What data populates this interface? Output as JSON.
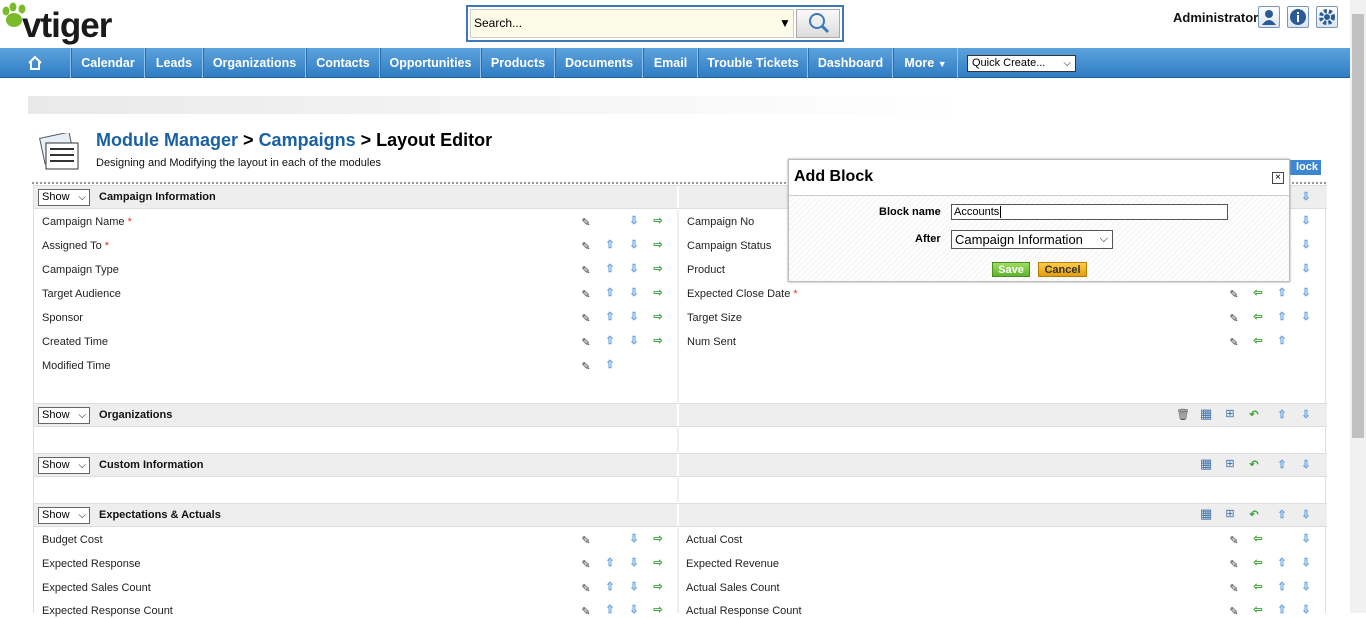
{
  "app": {
    "brand": "vtiger"
  },
  "search": {
    "placeholder": "Search..."
  },
  "user": {
    "name": "Administrator"
  },
  "nav": {
    "items": [
      "Calendar",
      "Leads",
      "Organizations",
      "Contacts",
      "Opportunities",
      "Products",
      "Documents",
      "Email",
      "Trouble Tickets",
      "Dashboard",
      "More"
    ],
    "quick_create": "Quick Create..."
  },
  "page": {
    "breadcrumb_1": "Module Manager",
    "sep": ">",
    "breadcrumb_2": "Campaigns",
    "breadcrumb_3": "Layout Editor",
    "subtitle": "Designing and Modifying the layout in each of the modules",
    "add_block_partial": "lock"
  },
  "show_label": "Show",
  "blocks": [
    {
      "title": "Campaign Information",
      "left": [
        "Campaign Name",
        "Assigned To",
        "Campaign Type",
        "Target Audience",
        "Sponsor",
        "Created Time",
        "Modified Time"
      ],
      "right": [
        "Campaign No",
        "Campaign Status",
        "Product",
        "Expected Close Date",
        "Target Size",
        "Num Sent"
      ],
      "required": [
        "Campaign Name",
        "Assigned To",
        "Expected Close Date"
      ]
    },
    {
      "title": "Organizations"
    },
    {
      "title": "Custom Information"
    },
    {
      "title": "Expectations & Actuals",
      "left": [
        "Budget Cost",
        "Expected Response",
        "Expected Sales Count",
        "Expected Response Count"
      ],
      "right": [
        "Actual Cost",
        "Expected Revenue",
        "Actual Sales Count",
        "Actual Response Count"
      ]
    }
  ],
  "popup": {
    "title": "Add Block",
    "block_name_label": "Block name",
    "block_name_value": "Accounts",
    "after_label": "After",
    "after_value": "Campaign Information",
    "save": "Save",
    "cancel": "Cancel"
  }
}
